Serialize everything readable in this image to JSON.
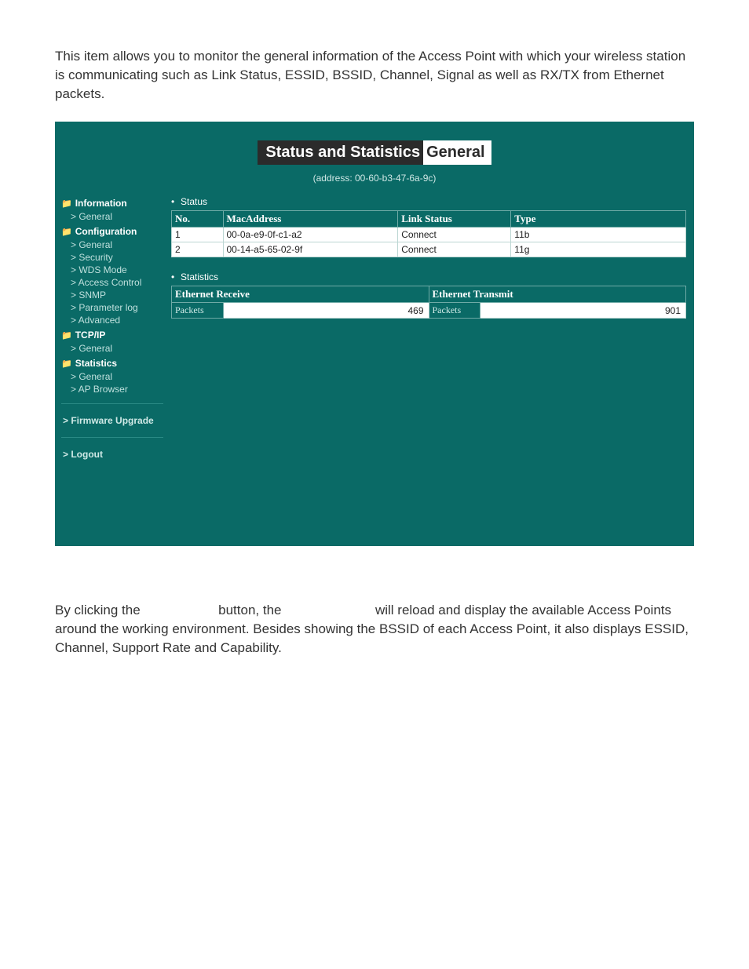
{
  "intro_text": "This item allows you to monitor the general information of the Access Point with which your wireless station is communicating such as Link Status, ESSID, BSSID, Channel, Signal as well as RX/TX from Ethernet packets.",
  "screenshot": {
    "title_main": "Status and Statistics",
    "title_sub": "General",
    "address_line": "(address: 00-60-b3-47-6a-9c)",
    "sidebar": {
      "groups": [
        {
          "label": "Information",
          "items": [
            "> General"
          ]
        },
        {
          "label": "Configuration",
          "items": [
            "> General",
            "> Security",
            "> WDS Mode",
            "> Access Control",
            "> SNMP",
            "> Parameter log",
            "> Advanced"
          ]
        },
        {
          "label": "TCP/IP",
          "items": [
            "> General"
          ]
        },
        {
          "label": "Statistics",
          "items": [
            "> General",
            "> AP Browser"
          ]
        }
      ],
      "footer": [
        "> Firmware Upgrade",
        "> Logout"
      ]
    },
    "status": {
      "heading": "Status",
      "columns": [
        "No.",
        "MacAddress",
        "Link Status",
        "Type"
      ],
      "rows": [
        {
          "no": "1",
          "mac": "00-0a-e9-0f-c1-a2",
          "link": "Connect",
          "type": "11b"
        },
        {
          "no": "2",
          "mac": "00-14-a5-65-02-9f",
          "link": "Connect",
          "type": "11g"
        }
      ]
    },
    "statistics": {
      "heading": "Statistics",
      "rx_header": "Ethernet Receive",
      "tx_header": "Ethernet Transmit",
      "row_label": "Packets",
      "rx_value": "469",
      "tx_value": "901"
    }
  },
  "outro": {
    "seg1": "By clicking the",
    "seg2": "button, the",
    "seg3": "will reload and display the available Access Points around the working environment. Besides showing the BSSID of each Access Point, it also displays ESSID, Channel, Support Rate and Capability."
  }
}
